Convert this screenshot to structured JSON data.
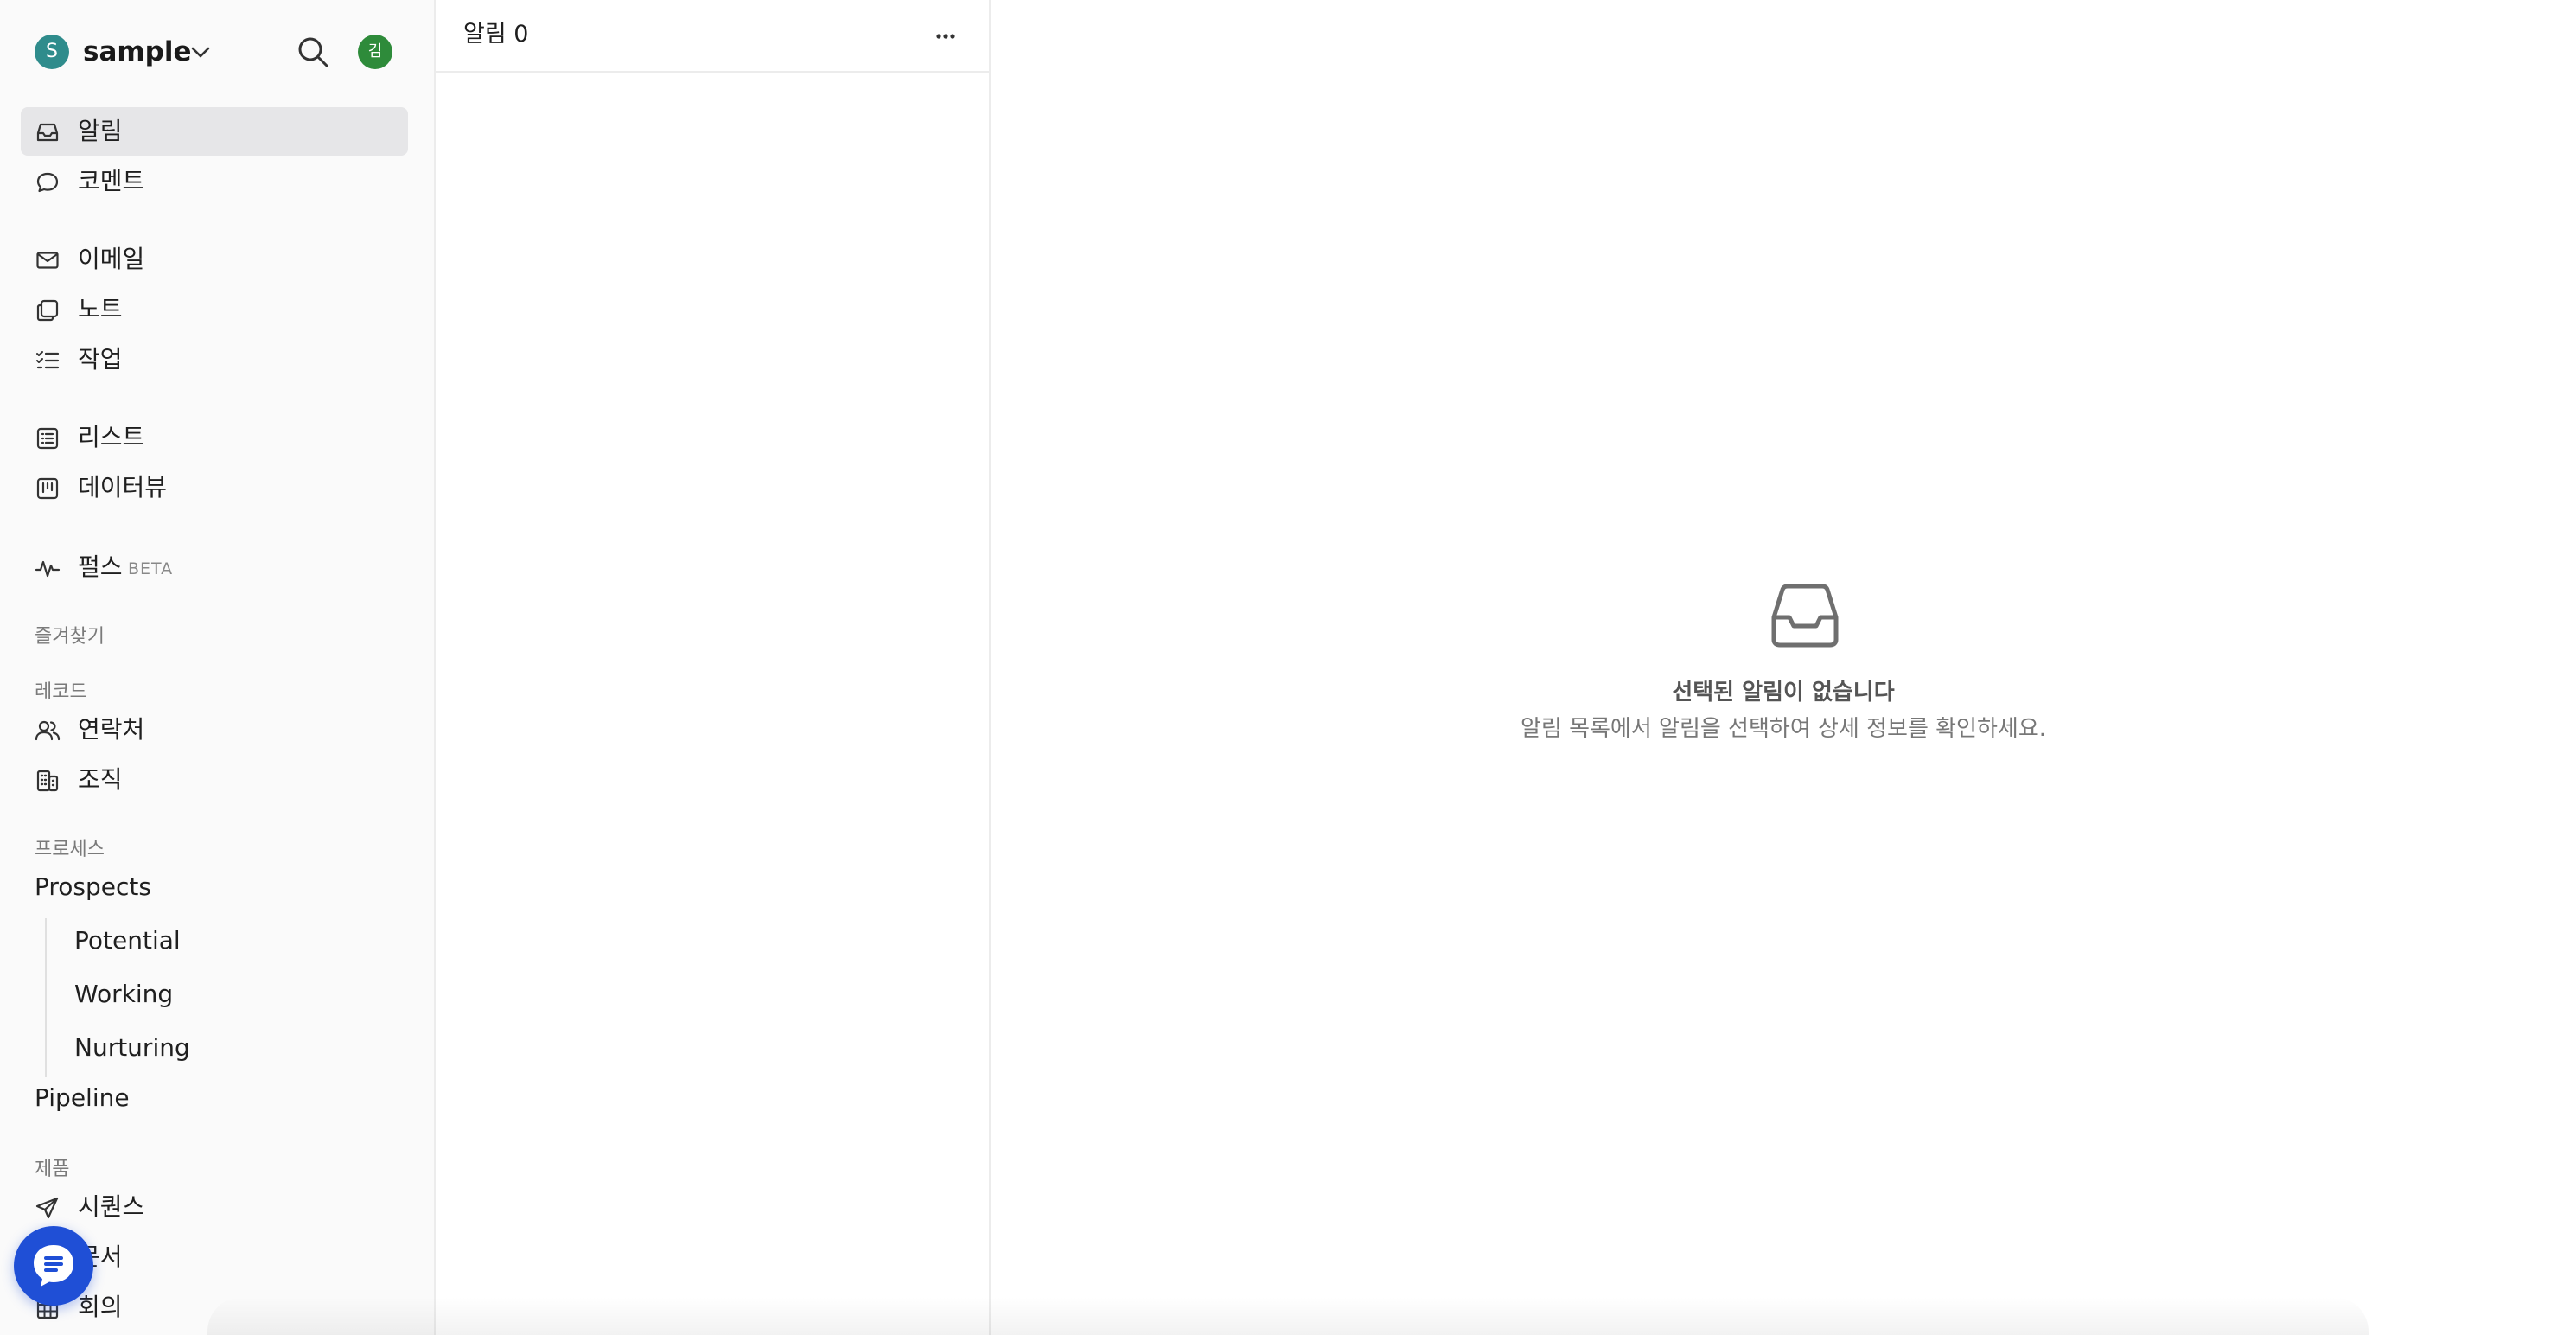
{
  "workspace": {
    "avatar_letter": "S",
    "name": "sample",
    "user_avatar": "김"
  },
  "sidebar": {
    "items": [
      {
        "label": "알림",
        "icon": "inbox-icon"
      },
      {
        "label": "코멘트",
        "icon": "comment-icon"
      },
      {
        "label": "이메일",
        "icon": "mail-icon"
      },
      {
        "label": "노트",
        "icon": "note-icon"
      },
      {
        "label": "작업",
        "icon": "task-list-icon"
      },
      {
        "label": "리스트",
        "icon": "list-icon"
      },
      {
        "label": "데이터뷰",
        "icon": "dataview-icon"
      },
      {
        "label": "펄스",
        "icon": "pulse-icon",
        "badge": "BETA"
      }
    ],
    "favorites_label": "즐겨찾기",
    "records": {
      "label": "레코드",
      "items": [
        {
          "label": "연락처",
          "icon": "people-icon"
        },
        {
          "label": "조직",
          "icon": "building-icon"
        }
      ]
    },
    "process": {
      "label": "프로세스",
      "prospects": "Prospects",
      "sub_items": [
        "Potential",
        "Working",
        "Nurturing"
      ],
      "pipeline": "Pipeline"
    },
    "products": {
      "label": "제품",
      "items": [
        {
          "label": "시퀀스",
          "icon": "send-icon"
        },
        {
          "label": "문서",
          "icon": "document-icon"
        },
        {
          "label": "회의",
          "icon": "table-icon"
        }
      ]
    }
  },
  "list_pane": {
    "title": "알림 0"
  },
  "detail": {
    "empty_title": "선택된 알림이 없습니다",
    "empty_subtitle": "알림 목록에서 알림을 선택하여 상세 정보를 확인하세요."
  },
  "colors": {
    "accent": "#1f4fd6",
    "workspace_avatar": "#2f8c8c",
    "user_avatar": "#2e8b3a",
    "active_bg": "#e6e6e8"
  }
}
